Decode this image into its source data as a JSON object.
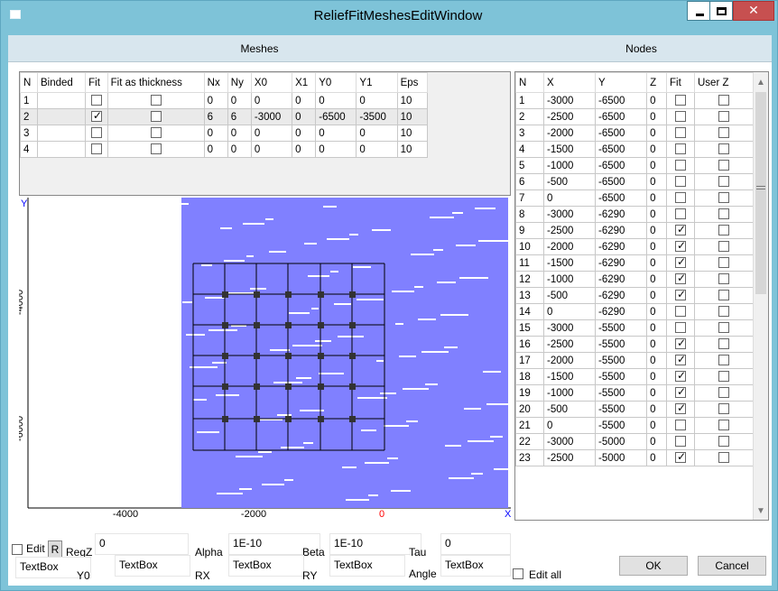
{
  "window": {
    "title": "ReliefFitMeshesEditWindow"
  },
  "meshes": {
    "header": "Meshes",
    "columns": [
      "N",
      "Binded",
      "Fit",
      "Fit as thickness",
      "Nx",
      "Ny",
      "X0",
      "X1",
      "Y0",
      "Y1",
      "Eps"
    ],
    "rows": [
      {
        "N": "1",
        "Binded": "",
        "Fit": false,
        "FitThickness": false,
        "Nx": "0",
        "Ny": "0",
        "X0": "0",
        "X1": "0",
        "Y0": "0",
        "Y1": "0",
        "Eps": "10"
      },
      {
        "N": "2",
        "Binded": "",
        "Fit": true,
        "FitThickness": false,
        "Nx": "6",
        "Ny": "6",
        "X0": "-3000",
        "X1": "0",
        "Y0": "-6500",
        "Y1": "-3500",
        "Eps": "10"
      },
      {
        "N": "3",
        "Binded": "",
        "Fit": false,
        "FitThickness": false,
        "Nx": "0",
        "Ny": "0",
        "X0": "0",
        "X1": "0",
        "Y0": "0",
        "Y1": "0",
        "Eps": "10"
      },
      {
        "N": "4",
        "Binded": "",
        "Fit": false,
        "FitThickness": false,
        "Nx": "0",
        "Ny": "0",
        "X0": "0",
        "X1": "0",
        "Y0": "0",
        "Y1": "0",
        "Eps": "10"
      }
    ],
    "selected_row": 1
  },
  "plot": {
    "x_ticks": [
      "-4000",
      "-2000",
      "0"
    ],
    "y_ticks": [
      "-4000",
      "-6000"
    ],
    "x_axis_label": "X",
    "y_axis_label": "Y",
    "relief_color": "#8080ff",
    "mesh_color": "#000000"
  },
  "nodes": {
    "header": "Nodes",
    "columns": [
      "N",
      "X",
      "Y",
      "Z",
      "Fit",
      "User Z"
    ],
    "rows": [
      {
        "N": "1",
        "X": "-3000",
        "Y": "-6500",
        "Z": "0",
        "Fit": false,
        "UserZ": false
      },
      {
        "N": "2",
        "X": "-2500",
        "Y": "-6500",
        "Z": "0",
        "Fit": false,
        "UserZ": false
      },
      {
        "N": "3",
        "X": "-2000",
        "Y": "-6500",
        "Z": "0",
        "Fit": false,
        "UserZ": false
      },
      {
        "N": "4",
        "X": "-1500",
        "Y": "-6500",
        "Z": "0",
        "Fit": false,
        "UserZ": false
      },
      {
        "N": "5",
        "X": "-1000",
        "Y": "-6500",
        "Z": "0",
        "Fit": false,
        "UserZ": false
      },
      {
        "N": "6",
        "X": "-500",
        "Y": "-6500",
        "Z": "0",
        "Fit": false,
        "UserZ": false
      },
      {
        "N": "7",
        "X": "0",
        "Y": "-6500",
        "Z": "0",
        "Fit": false,
        "UserZ": false
      },
      {
        "N": "8",
        "X": "-3000",
        "Y": "-6290",
        "Z": "0",
        "Fit": false,
        "UserZ": false
      },
      {
        "N": "9",
        "X": "-2500",
        "Y": "-6290",
        "Z": "0",
        "Fit": true,
        "UserZ": false
      },
      {
        "N": "10",
        "X": "-2000",
        "Y": "-6290",
        "Z": "0",
        "Fit": true,
        "UserZ": false
      },
      {
        "N": "11",
        "X": "-1500",
        "Y": "-6290",
        "Z": "0",
        "Fit": true,
        "UserZ": false
      },
      {
        "N": "12",
        "X": "-1000",
        "Y": "-6290",
        "Z": "0",
        "Fit": true,
        "UserZ": false
      },
      {
        "N": "13",
        "X": "-500",
        "Y": "-6290",
        "Z": "0",
        "Fit": true,
        "UserZ": false
      },
      {
        "N": "14",
        "X": "0",
        "Y": "-6290",
        "Z": "0",
        "Fit": false,
        "UserZ": false
      },
      {
        "N": "15",
        "X": "-3000",
        "Y": "-5500",
        "Z": "0",
        "Fit": false,
        "UserZ": false
      },
      {
        "N": "16",
        "X": "-2500",
        "Y": "-5500",
        "Z": "0",
        "Fit": true,
        "UserZ": false
      },
      {
        "N": "17",
        "X": "-2000",
        "Y": "-5500",
        "Z": "0",
        "Fit": true,
        "UserZ": false
      },
      {
        "N": "18",
        "X": "-1500",
        "Y": "-5500",
        "Z": "0",
        "Fit": true,
        "UserZ": false
      },
      {
        "N": "19",
        "X": "-1000",
        "Y": "-5500",
        "Z": "0",
        "Fit": true,
        "UserZ": false
      },
      {
        "N": "20",
        "X": "-500",
        "Y": "-5500",
        "Z": "0",
        "Fit": true,
        "UserZ": false
      },
      {
        "N": "21",
        "X": "0",
        "Y": "-5500",
        "Z": "0",
        "Fit": false,
        "UserZ": false
      },
      {
        "N": "22",
        "X": "-3000",
        "Y": "-5000",
        "Z": "0",
        "Fit": false,
        "UserZ": false
      },
      {
        "N": "23",
        "X": "-2500",
        "Y": "-5000",
        "Z": "0",
        "Fit": true,
        "UserZ": false
      }
    ]
  },
  "controls": {
    "edit_label": "Edit",
    "r_label": "R",
    "regz_label": "RegZ",
    "regz_value": "0",
    "alpha_label": "Alpha",
    "alpha_value": "1E-10",
    "beta_label": "Beta",
    "beta_value": "1E-10",
    "tau_label": "Tau",
    "tau_value": "0",
    "y0_label": "Y0",
    "rx_label": "RX",
    "ry_label": "RY",
    "angle_label": "Angle",
    "textbox_1": "TextBox",
    "textbox_2": "TextBox",
    "textbox_3": "TextBox",
    "textbox_4": "TextBox",
    "textbox_5": "TextBox",
    "edit_all_label": "Edit all",
    "ok_label": "OK",
    "cancel_label": "Cancel"
  }
}
